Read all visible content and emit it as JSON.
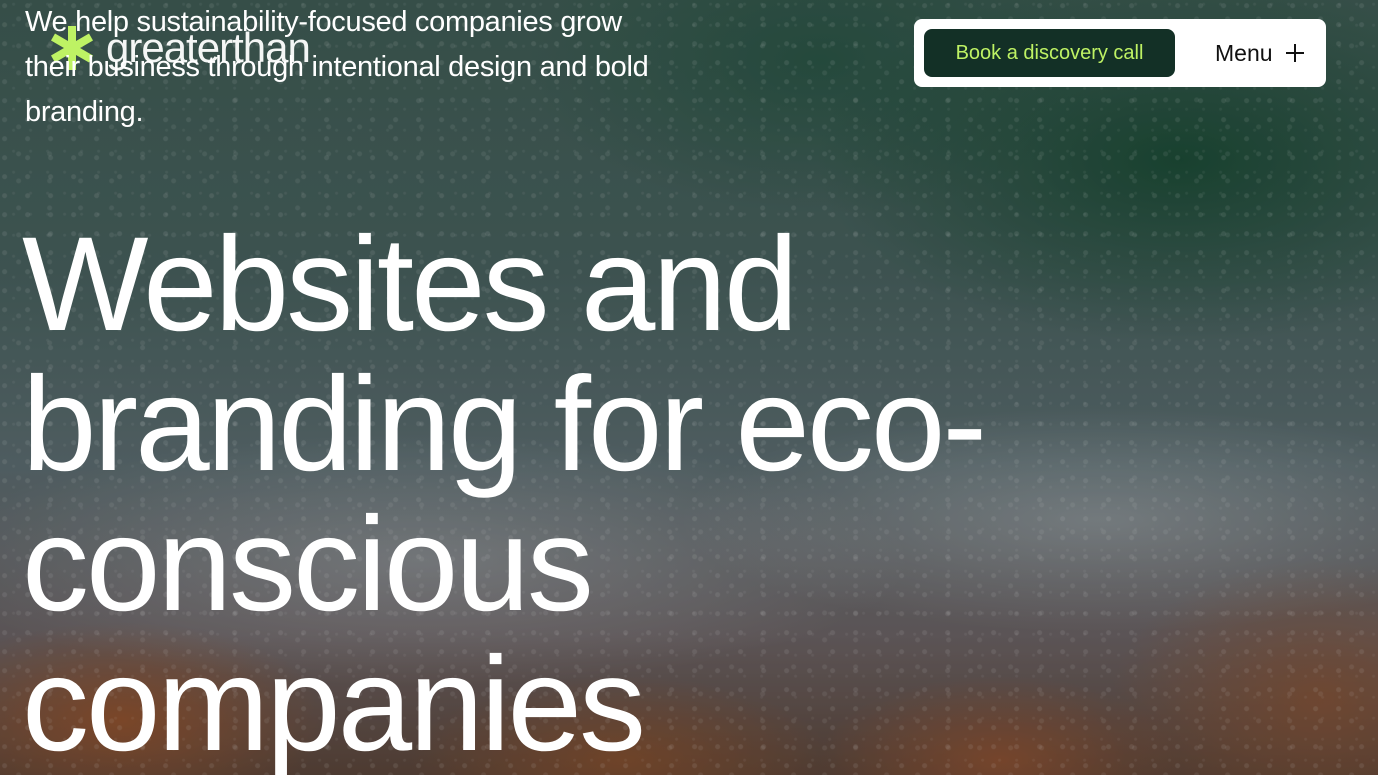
{
  "brand": {
    "name": "greaterthan",
    "accent_color": "#bef264",
    "dark_color": "#133026"
  },
  "hero": {
    "tagline": "We help sustainability-focused companies grow their business through intentional design and bold branding.",
    "headline_lines": [
      "Websites and",
      "branding for eco-",
      "conscious",
      "companies"
    ]
  },
  "nav": {
    "cta_label": "Book a discovery call",
    "menu_label": "Menu",
    "menu_icon": "plus-icon"
  },
  "logo_icon": "asterisk-logo-icon"
}
